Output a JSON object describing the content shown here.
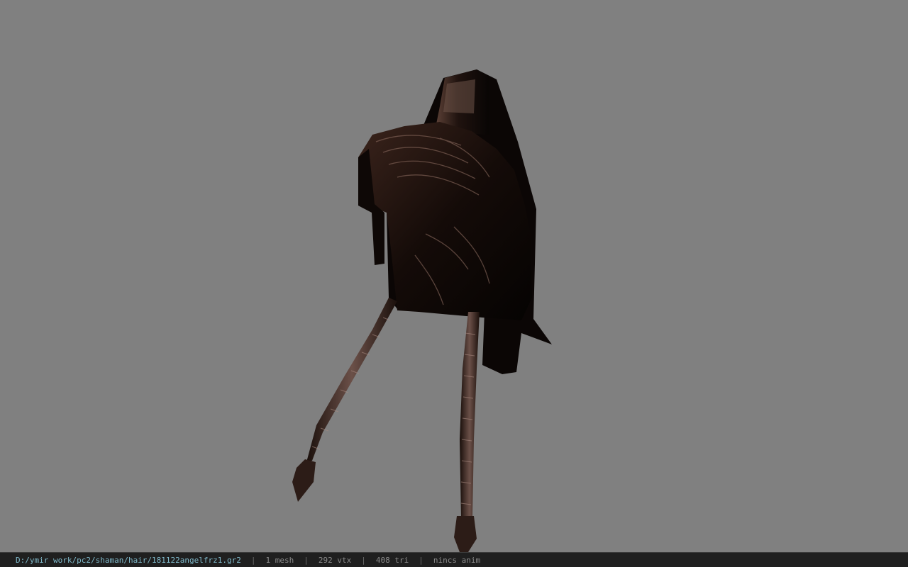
{
  "viewer": {
    "background_color": "#808080",
    "model_icon": "hair-mesh-model"
  },
  "status": {
    "file_path": "D:/ymir work/pc2/shaman/hair/181122angelfrz1.gr2",
    "separator": "|",
    "mesh_count": "1 mesh",
    "vertex_count": "292 vtx",
    "triangle_count": "408 tri",
    "anim_status": "nincs anim"
  }
}
